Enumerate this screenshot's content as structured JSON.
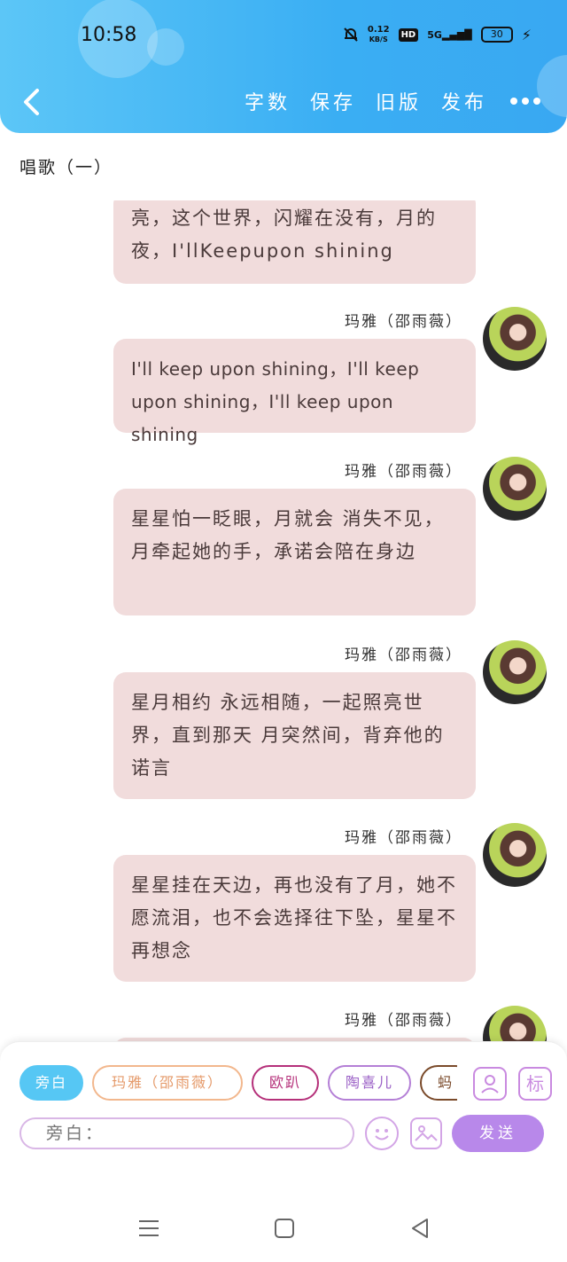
{
  "status_bar": {
    "time": "10:58",
    "net_speed": "0.12",
    "net_unit": "KB/S",
    "hd": "HD",
    "signal": "5G",
    "battery": "30"
  },
  "header": {
    "buttons": [
      "字数",
      "保存",
      "旧版",
      "发布"
    ]
  },
  "doc_title": "唱歌（一）",
  "messages": [
    {
      "speaker": "",
      "text": "亮，这个世界，闪耀在没有，月的夜，I'llKeepupon shining",
      "en": false
    },
    {
      "speaker": "玛雅（邵雨薇）",
      "text": "I'll keep upon shining，I'll keep upon shining，I'll keep upon shining",
      "en": true
    },
    {
      "speaker": "玛雅（邵雨薇）",
      "text": "星星怕一眨眼，月就会 消失不见，月牵起她的手，承诺会陪在身边",
      "en": false
    },
    {
      "speaker": "玛雅（邵雨薇）",
      "text": "星月相约 永远相随，一起照亮世界，直到那天 月突然间，背弃他的诺言",
      "en": false
    },
    {
      "speaker": "玛雅（邵雨薇）",
      "text": "星星挂在天边，再也没有了月，她不愿流泪，也不会选择往下坠，星星不再想念",
      "en": false
    },
    {
      "speaker": "玛雅（邵雨薇）",
      "text": "",
      "en": false
    }
  ],
  "chips": [
    "旁白",
    "玛雅（邵雨薇）",
    "欧趴",
    "陶喜儿",
    "蚂"
  ],
  "side_buttons": {
    "role": "",
    "tag": "标"
  },
  "input": {
    "placeholder": "旁白："
  },
  "send_label": "发送"
}
